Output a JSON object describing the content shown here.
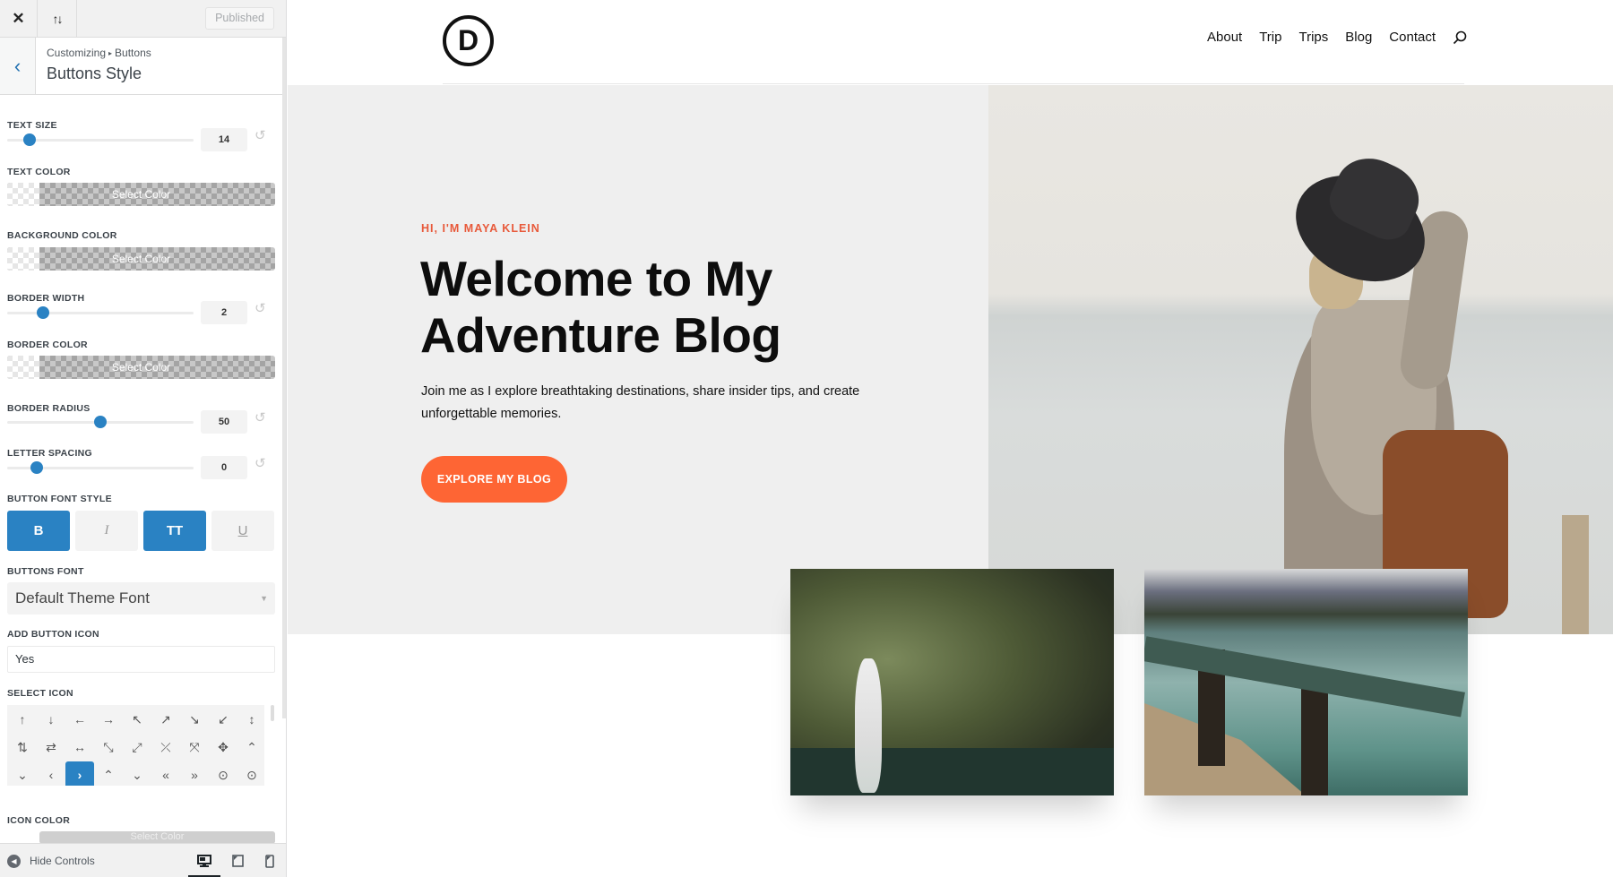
{
  "customizer": {
    "topbar": {
      "close_icon": "✕",
      "sort_icon": "↑↓",
      "publish_label": "Published"
    },
    "section": {
      "back_icon": "‹",
      "breadcrumb_root": "Customizing",
      "breadcrumb_sep": "▸",
      "breadcrumb_leaf": "Buttons",
      "title": "Buttons Style"
    },
    "controls": {
      "text_size": {
        "label": "Text Size",
        "value": "14",
        "fraction": 0.12
      },
      "text_color": {
        "label": "Text Color",
        "button": "Select Color"
      },
      "background_color": {
        "label": "Background Color",
        "button": "Select Color"
      },
      "border_width": {
        "label": "Border Width",
        "value": "2",
        "fraction": 0.19
      },
      "border_color": {
        "label": "Border Color",
        "button": "Select Color"
      },
      "border_radius": {
        "label": "Border Radius",
        "value": "50",
        "fraction": 0.5
      },
      "letter_spacing": {
        "label": "Letter Spacing",
        "value": "0",
        "fraction": 0.16
      },
      "reset_icon": "↺",
      "font_style": {
        "label": "Button Font Style",
        "options": [
          {
            "label": "B",
            "name": "bold",
            "active": true
          },
          {
            "label": "I",
            "name": "italic",
            "active": false
          },
          {
            "label": "TT",
            "name": "uppercase",
            "active": true
          },
          {
            "label": "U",
            "name": "underline",
            "active": false
          }
        ]
      },
      "buttons_font": {
        "label": "Buttons Font",
        "value": "Default Theme Font",
        "caret": "▼"
      },
      "add_icon": {
        "label": "Add Button Icon",
        "value": "Yes"
      },
      "select_icon": {
        "label": "Select Icon",
        "rows": [
          [
            "↑",
            "↓",
            "←",
            "→",
            "↖",
            "↗",
            "↘",
            "↙",
            "↕"
          ],
          [
            "⇅",
            "⇄",
            "↔",
            "⤡",
            "⤢",
            "⤫",
            "⤧",
            "✥",
            "⌃"
          ],
          [
            "⌄",
            "‹",
            "›",
            "⌃",
            "⌄",
            "«",
            "»",
            "⊙",
            "⊙"
          ]
        ],
        "selected": "›"
      },
      "icon_color": {
        "label": "Icon Color",
        "button": "Select Color"
      }
    },
    "footer": {
      "hide_label": "Hide Controls",
      "hide_icon": "◀",
      "devices": [
        "desktop",
        "tablet",
        "mobile"
      ],
      "active_device": "desktop"
    }
  },
  "site": {
    "logo_letter": "D",
    "nav": [
      "About",
      "Trip",
      "Trips",
      "Blog",
      "Contact"
    ],
    "hero": {
      "subheading": "HI, I'M MAYA KLEIN",
      "title_line1": "Welcome to My",
      "title_line2": "Adventure Blog",
      "text": "Join me as I explore breathtaking destinations, share insider tips, and create unforgettable memories.",
      "button": "EXPLORE MY BLOG"
    },
    "colors": {
      "accent": "#fe6534",
      "subheading": "#e8593a",
      "control_blue": "#2a82c3",
      "hero_bg": "#efefef"
    }
  }
}
